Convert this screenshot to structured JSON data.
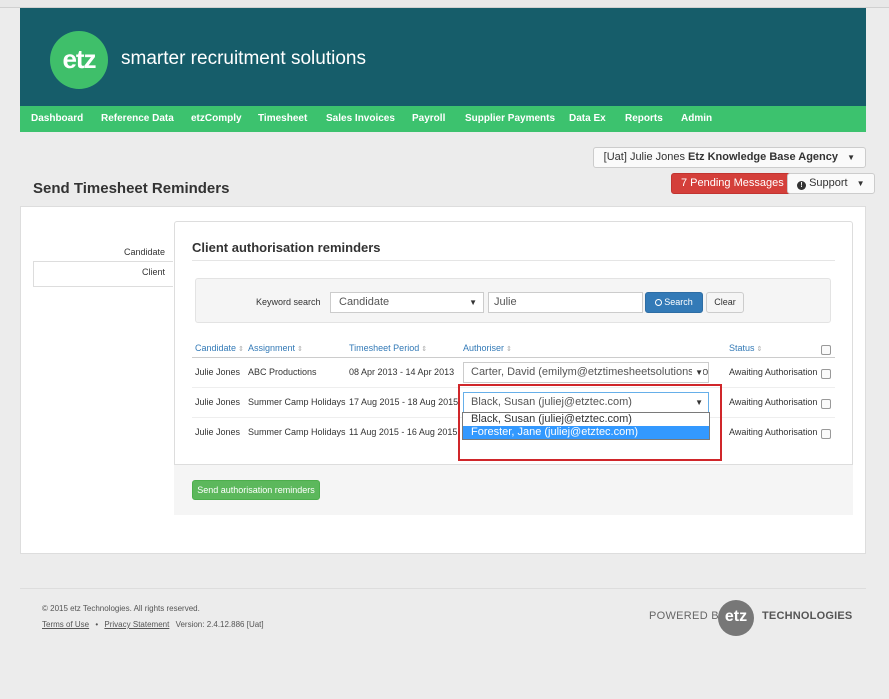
{
  "header": {
    "logo_text": "etz",
    "tagline": "smarter recruitment solutions"
  },
  "nav": {
    "items": [
      "Dashboard",
      "Reference Data",
      "etzComply",
      "Timesheet",
      "Sales Invoices",
      "Payroll",
      "Supplier Payments",
      "Data Ex",
      "Reports",
      "Admin"
    ]
  },
  "topbar": {
    "agency_prefix": "[Uat] Julie Jones",
    "agency_name": "Etz Knowledge Base Agency",
    "pending_label": "7 Pending Messages",
    "support_label": "Support"
  },
  "page": {
    "title": "Send Timesheet Reminders"
  },
  "sidebar": {
    "items": [
      {
        "label": "Candidate"
      },
      {
        "label": "Client"
      }
    ]
  },
  "main": {
    "section_title": "Client authorisation reminders",
    "search": {
      "keyword_label": "Keyword search",
      "type_selected": "Candidate",
      "keyword_value": "Julie",
      "search_label": "Search",
      "clear_label": "Clear"
    },
    "table": {
      "headers": [
        "Candidate",
        "Assignment",
        "Timesheet Period",
        "Authoriser",
        "Status"
      ],
      "rows": [
        {
          "candidate": "Julie Jones",
          "assignment": "ABC Productions",
          "period": "08 Apr 2013 - 14 Apr 2013",
          "authoriser": "Carter, David (emilym@etztimesheetsolutions.cor",
          "status": "Awaiting Authorisation"
        },
        {
          "candidate": "Julie Jones",
          "assignment": "Summer Camp Holidays",
          "period": "17 Aug 2015 - 18 Aug 2015",
          "authoriser": "Black, Susan (juliej@etztec.com)",
          "status": "Awaiting Authorisation"
        },
        {
          "candidate": "Julie Jones",
          "assignment": "Summer Camp Holidays",
          "period": "11 Aug 2015 - 16 Aug 2015",
          "authoriser": "",
          "status": "Awaiting Authorisation"
        }
      ]
    },
    "dropdown": {
      "options": [
        "Black, Susan (juliej@etztec.com)",
        "Forester, Jane (juliej@etztec.com)"
      ],
      "selected_index": 1
    },
    "send_label": "Send authorisation reminders"
  },
  "footer": {
    "copyright": "© 2015 etz Technologies. All rights reserved.",
    "terms": "Terms of Use",
    "separator": "•",
    "privacy": "Privacy Statement",
    "version": "Version: 2.4.12.886 [Uat]",
    "powered_by": "POWERED BY",
    "powered_logo": "etz",
    "powered_tech": "TECHNOLOGIES"
  },
  "colors": {
    "header": "#165d6a",
    "nav": "#3cc26e",
    "logo": "#3fbf6a",
    "danger": "#d43f3a",
    "primary": "#337ab7",
    "success": "#5cb85c",
    "highlight": "#d0262a"
  }
}
